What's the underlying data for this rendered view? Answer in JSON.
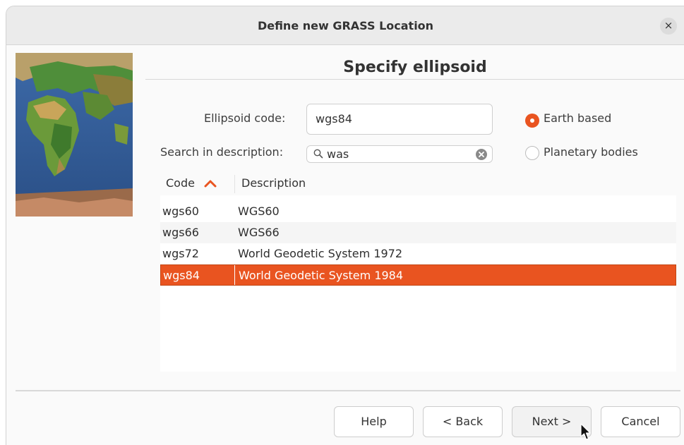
{
  "window": {
    "title": "Define new GRASS Location",
    "close_glyph": "×"
  },
  "page": {
    "heading": "Specify ellipsoid"
  },
  "form": {
    "code_label": "Ellipsoid code:",
    "code_value": "wgs84",
    "search_label": "Search in description:",
    "search_value": "was",
    "radio_earth": "Earth based",
    "radio_planetary": "Planetary bodies",
    "selected_radio": "Earth based"
  },
  "table": {
    "columns": [
      "Code",
      "Description"
    ],
    "sort_column": "Code",
    "sort_direction": "ascending",
    "rows": [
      {
        "code": "wgs60",
        "description": "WGS60"
      },
      {
        "code": "wgs66",
        "description": "WGS66"
      },
      {
        "code": "wgs72",
        "description": "World Geodetic System 1972"
      },
      {
        "code": "wgs84",
        "description": "World Geodetic System 1984"
      }
    ],
    "selected_code": "wgs84"
  },
  "buttons": {
    "help": "Help",
    "back": "< Back",
    "next": "Next >",
    "cancel": "Cancel"
  },
  "icons": [
    "close-icon",
    "search-icon",
    "clear-search-icon",
    "sort-ascending-icon",
    "mouse-pointer-icon"
  ],
  "colors": {
    "accent": "#e95420",
    "titlebar": "#ebebeb",
    "window_bg": "#fafafa"
  }
}
